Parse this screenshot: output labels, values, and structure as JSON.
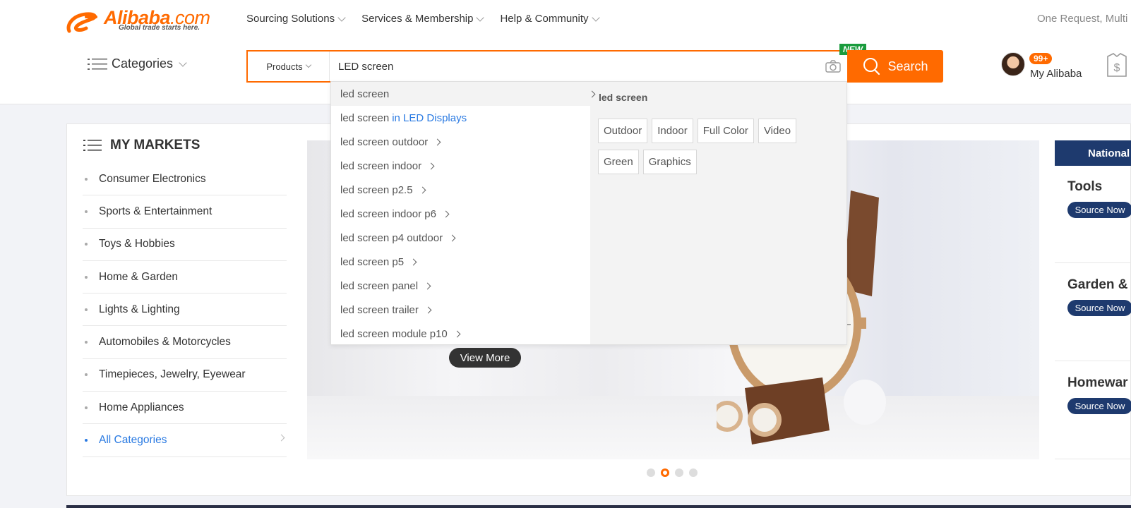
{
  "brand": {
    "name": "Alibaba",
    "domain": ".com",
    "tagline": "Global trade starts here.",
    "color": "#ff6a00"
  },
  "topnav": [
    {
      "label": "Sourcing Solutions"
    },
    {
      "label": "Services & Membership"
    },
    {
      "label": "Help & Community"
    }
  ],
  "top_right_text": "One Request, Multi",
  "categories_label": "Categories",
  "search": {
    "type_label": "Products",
    "value": "LED screen",
    "button_label": "Search",
    "new_badge": "NEW"
  },
  "account": {
    "badge": "99+",
    "label": "My Alibaba"
  },
  "markets": {
    "title": "MY MARKETS",
    "items": [
      "Consumer Electronics",
      "Sports & Entertainment",
      "Toys & Hobbies",
      "Home & Garden",
      "Lights & Lighting",
      "Automobiles & Motorcycles",
      "Timepieces, Jewelry, Eyewear",
      "Home Appliances"
    ],
    "all_label": "All Categories"
  },
  "banner": {
    "button_label": "View More",
    "slide_count": 4,
    "active_slide": 2
  },
  "right_column": {
    "header": "National",
    "blocks": [
      {
        "title": "Tools",
        "button": "Source Now"
      },
      {
        "title": "Garden &",
        "button": "Source Now"
      },
      {
        "title": "Homewar",
        "button": "Source Now"
      }
    ]
  },
  "autocomplete": {
    "suggestions": [
      {
        "text": "led screen",
        "hint": ""
      },
      {
        "text": "led screen",
        "hint": "in LED Displays"
      },
      {
        "text": "led screen outdoor",
        "hint": ""
      },
      {
        "text": "led screen indoor",
        "hint": ""
      },
      {
        "text": "led screen p2.5",
        "hint": ""
      },
      {
        "text": "led screen indoor p6",
        "hint": ""
      },
      {
        "text": "led screen p4 outdoor",
        "hint": ""
      },
      {
        "text": "led screen p5",
        "hint": ""
      },
      {
        "text": "led screen panel",
        "hint": ""
      },
      {
        "text": "led screen trailer",
        "hint": ""
      },
      {
        "text": "led screen module p10",
        "hint": ""
      }
    ],
    "related_title": "led screen",
    "related_tags": [
      "Outdoor",
      "Indoor",
      "Full Color",
      "Video",
      "Green",
      "Graphics"
    ]
  }
}
